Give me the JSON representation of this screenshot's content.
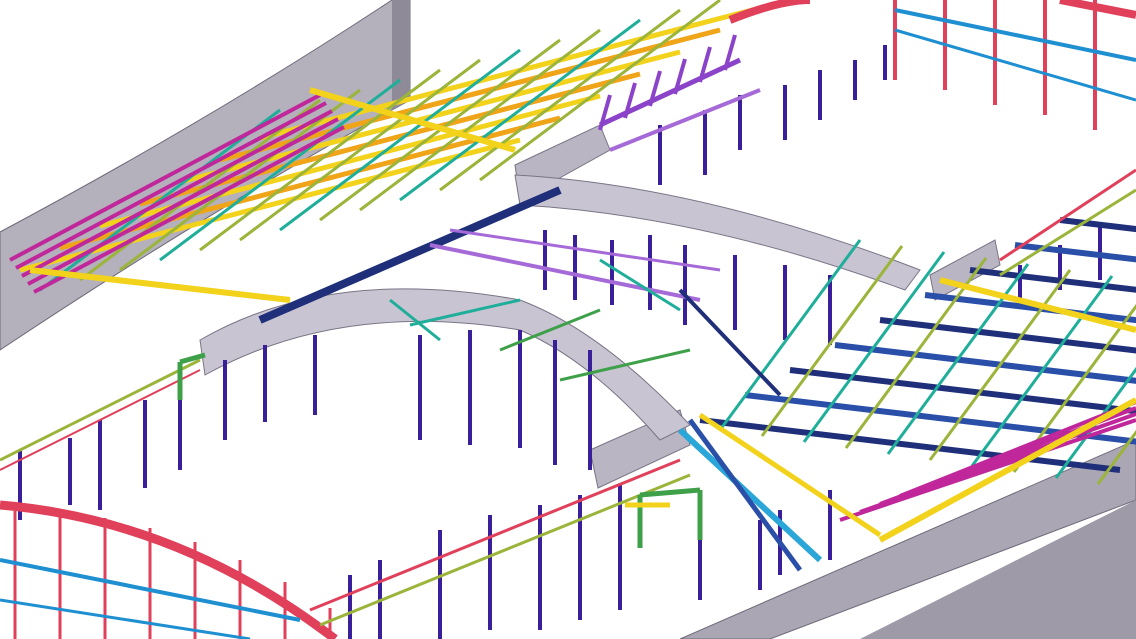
{
  "view": {
    "background": "#ffffff"
  },
  "palette": {
    "wall_fill": "#b7b3bf",
    "wall_stroke": "#6f6a7a",
    "wall_dark": "#8f8a98",
    "column": "#3a1f9a",
    "beam_yellow": "#f2d21a",
    "beam_orange": "#f0a417",
    "beam_olive": "#9bb43a",
    "beam_magenta": "#c0279a",
    "beam_purple": "#8b43c9",
    "beam_violet": "#a56ad8",
    "beam_teal": "#1fae9a",
    "beam_green": "#3fa04a",
    "beam_blue": "#2a4fa8",
    "beam_navy": "#1f2f7a",
    "beam_cyan": "#2aa6d8",
    "truss_red": "#e0405a",
    "truss_pink": "#e8607a",
    "truss_blue": "#1e8fd0",
    "arch_fill": "#c8c4d2",
    "arch_stroke": "#7a7586"
  }
}
